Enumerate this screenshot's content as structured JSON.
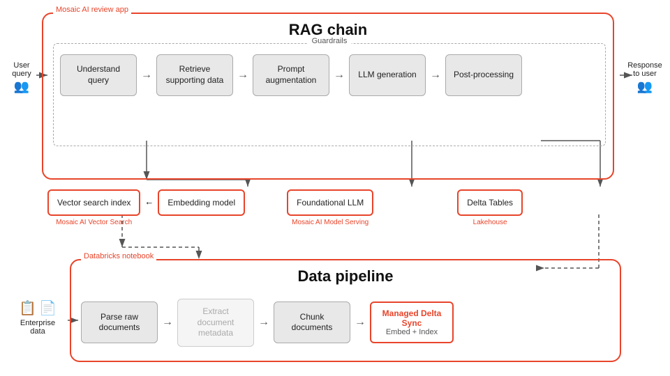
{
  "rag": {
    "section_label": "Mosaic AI review app",
    "title": "RAG chain",
    "guardrails_label": "Guardrails",
    "steps": [
      {
        "id": "understand",
        "text": "Understand query"
      },
      {
        "id": "retrieve",
        "text": "Retrieve supporting data"
      },
      {
        "id": "prompt",
        "text": "Prompt augmentation"
      },
      {
        "id": "llm",
        "text": "LLM generation"
      },
      {
        "id": "post",
        "text": "Post-processing"
      }
    ],
    "user_query": "User query",
    "response": "Response to user"
  },
  "middle": {
    "items": [
      {
        "id": "vector",
        "text": "Vector search index",
        "label": "Mosaic AI Vector Search",
        "border": "orange"
      },
      {
        "id": "embedding",
        "text": "Embedding model",
        "label": "",
        "border": "orange"
      },
      {
        "id": "foundational",
        "text": "Foundational LLM",
        "label": "Mosaic AI Model Serving",
        "border": "orange"
      },
      {
        "id": "delta",
        "text": "Delta Tables",
        "label": "Lakehouse",
        "border": "orange"
      }
    ]
  },
  "data_pipeline": {
    "section_label": "Databricks notebook",
    "title": "Data pipeline",
    "steps": [
      {
        "id": "parse",
        "text": "Parse raw documents",
        "style": "normal"
      },
      {
        "id": "extract",
        "text": "Extract document metadata",
        "style": "gray"
      },
      {
        "id": "chunk",
        "text": "Chunk documents",
        "style": "normal"
      },
      {
        "id": "managed",
        "title": "Managed Delta Sync",
        "subtitle": "Embed + Index",
        "style": "red"
      }
    ],
    "enterprise_label": "Enterprise data"
  }
}
